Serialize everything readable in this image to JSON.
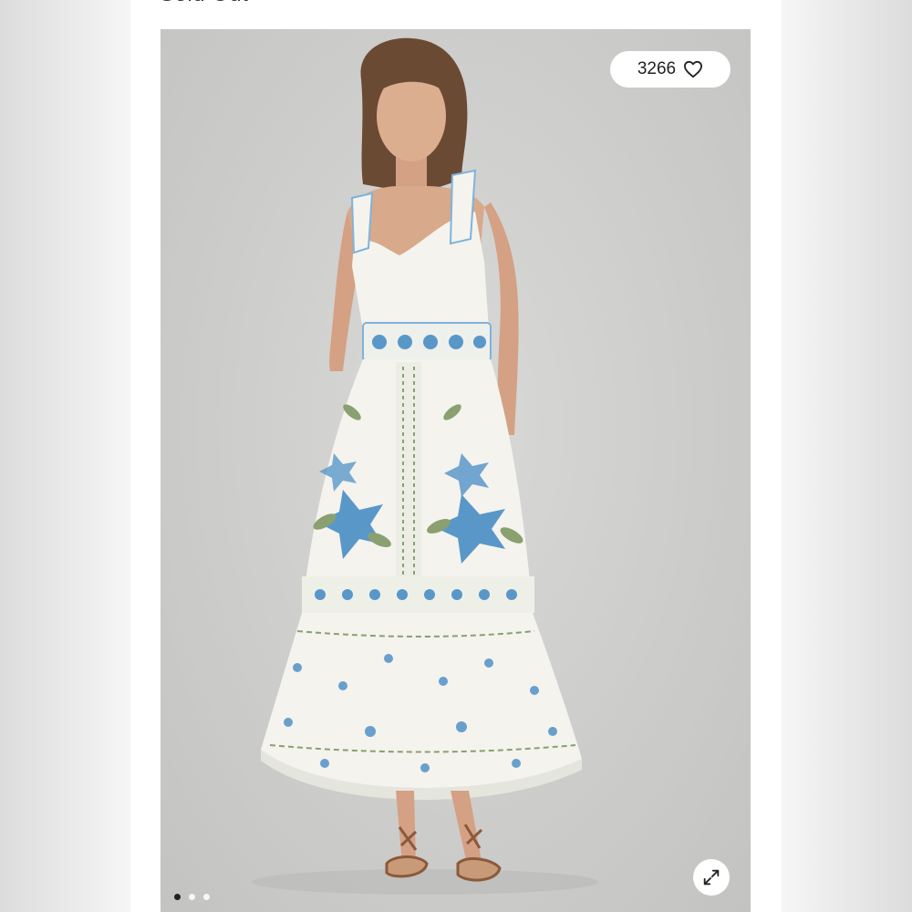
{
  "listing": {
    "status_label": "Sold Out",
    "likes_count": "3266",
    "like_icon": "heart-icon",
    "expand_icon": "expand-icon"
  },
  "gallery": {
    "image_count": 3,
    "active_index": 0
  },
  "colors": {
    "background": "#cfcfcd",
    "dress": "#f4f3ee",
    "floral_blue": "#5a97c9",
    "floral_green": "#8aa070",
    "skin": "#d8a98a",
    "hair": "#6b4a34",
    "sandal": "#8a5a3a"
  }
}
